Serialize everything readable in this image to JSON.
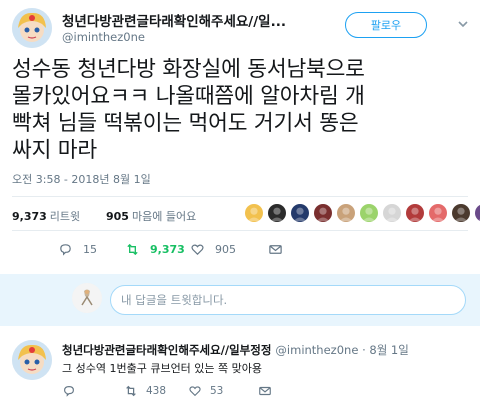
{
  "tweet": {
    "display_name": "청년다방관련글타래확인해주세요//일...",
    "handle": "@iminthez0ne",
    "follow_label": "팔로우",
    "text": "성수동 청년다방 화장실에 동서남북으로\n몰카있어요ㅋㅋ 나올때쯤에 알아차림 개\n빡쳐 님들 떡볶이는 먹어도 거기서 똥은\n싸지 마라",
    "timestamp": "오전 3:58 - 2018년 8월 1일",
    "retweets_count": "9,373",
    "retweets_label": "리트윗",
    "likes_count": "905",
    "likes_label": "마음에 들어요",
    "reply_count": "15",
    "retweet_action_count": "9,373",
    "like_action_count": "905"
  },
  "reply_box": {
    "placeholder": "내 답글을 트윗합니다."
  },
  "reply_tweet": {
    "display_name": "청년다방관련글타래확인해주세요//일부정정",
    "handle": "@iminthez0ne",
    "date": "8월 1일",
    "separator": "·",
    "text": "그 성수역 1번출구 큐브언터 있는 쪽 맞아용",
    "retweet_count": "438",
    "like_count": "53"
  },
  "colors": {
    "accent": "#1da1f2",
    "retweet_green": "#17bf63",
    "muted": "#657786",
    "reply_box_bg": "#e8f5fd"
  },
  "likers": [
    {
      "name": "liker-1",
      "color": "#f2c14e"
    },
    {
      "name": "liker-2",
      "color": "#2b2b2b"
    },
    {
      "name": "liker-3",
      "color": "#243a6b"
    },
    {
      "name": "liker-4",
      "color": "#7a2f2f"
    },
    {
      "name": "liker-5",
      "color": "#c9a27a"
    },
    {
      "name": "liker-6",
      "color": "#9bd36b"
    },
    {
      "name": "liker-7",
      "color": "#d6d6d6"
    },
    {
      "name": "liker-8",
      "color": "#b23b3b"
    },
    {
      "name": "liker-9",
      "color": "#e46a6a"
    },
    {
      "name": "liker-10",
      "color": "#4b3a2e"
    },
    {
      "name": "liker-11",
      "color": "#6a4a8a"
    }
  ]
}
